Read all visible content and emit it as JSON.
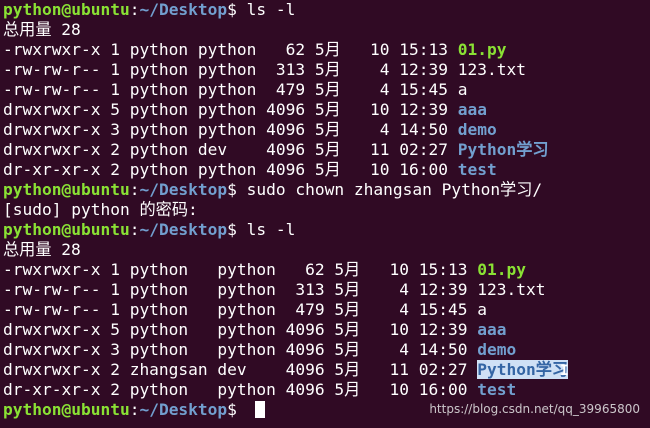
{
  "prompt": {
    "user_host": "python@ubuntu",
    "sep": ":",
    "path": "~/Desktop",
    "dollar": "$ "
  },
  "commands": {
    "ls1": "ls -l",
    "chown": "sudo chown zhangsan Python学习/",
    "sudo_prompt": "[sudo] python 的密码:",
    "ls2": "ls -l",
    "current": ""
  },
  "total": "总用量 28",
  "listing1": [
    {
      "meta": "-rwxrwxr-x 1 python python   62 5月   10 15:13 ",
      "name": "01.py",
      "kind": "exec"
    },
    {
      "meta": "-rw-rw-r-- 1 python python  313 5月    4 12:39 ",
      "name": "123.txt",
      "kind": "file"
    },
    {
      "meta": "-rw-rw-r-- 1 python python  479 5月    4 15:45 ",
      "name": "a",
      "kind": "file"
    },
    {
      "meta": "drwxrwxr-x 5 python python 4096 5月   10 12:39 ",
      "name": "aaa",
      "kind": "dir"
    },
    {
      "meta": "drwxrwxr-x 3 python python 4096 5月    4 14:50 ",
      "name": "demo",
      "kind": "dir"
    },
    {
      "meta": "drwxrwxr-x 2 python dev    4096 5月   11 02:27 ",
      "name": "Python学习",
      "kind": "dir"
    },
    {
      "meta": "dr-xr-xr-x 2 python python 4096 5月   10 16:00 ",
      "name": "test",
      "kind": "dir"
    }
  ],
  "listing2": [
    {
      "meta": "-rwxrwxr-x 1 python   python   62 5月   10 15:13 ",
      "name": "01.py",
      "kind": "exec"
    },
    {
      "meta": "-rw-rw-r-- 1 python   python  313 5月    4 12:39 ",
      "name": "123.txt",
      "kind": "file"
    },
    {
      "meta": "-rw-rw-r-- 1 python   python  479 5月    4 15:45 ",
      "name": "a",
      "kind": "file"
    },
    {
      "meta": "drwxrwxr-x 5 python   python 4096 5月   10 12:39 ",
      "name": "aaa",
      "kind": "dir"
    },
    {
      "meta": "drwxrwxr-x 3 python   python 4096 5月    4 14:50 ",
      "name": "demo",
      "kind": "dir"
    },
    {
      "meta": "drwxrwxr-x 2 zhangsan dev    4096 5月   11 02:27 ",
      "name": "Python学习",
      "kind": "dir-hl"
    },
    {
      "meta": "dr-xr-xr-x 2 python   python 4096 5月   10 16:00 ",
      "name": "test",
      "kind": "dir"
    }
  ],
  "mouse_cursor_glyph": "I",
  "watermark": "https://blog.csdn.net/qq_39965800",
  "colors": {
    "background": "#300a24",
    "prompt_user": "#8ae234",
    "prompt_path": "#729fcf",
    "directory": "#729fcf",
    "executable": "#8ae234",
    "text": "#ffffff"
  }
}
